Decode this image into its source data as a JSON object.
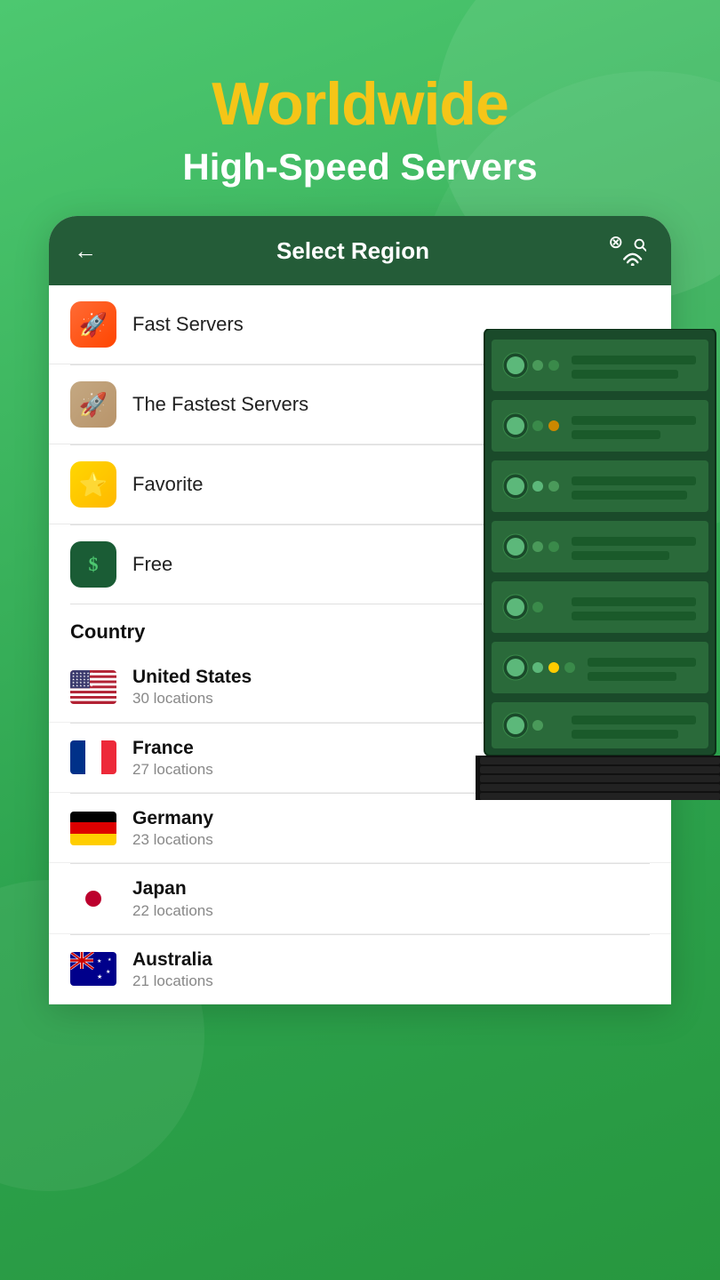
{
  "header": {
    "title_line1": "Worldwide",
    "title_line2": "High-Speed Servers"
  },
  "card": {
    "title": "Select Region",
    "back_label": "←"
  },
  "menu_items": [
    {
      "id": "fast-servers",
      "label": "Fast Servers",
      "icon": "🚀",
      "icon_style": "orange",
      "has_crown": false,
      "has_chevron": false
    },
    {
      "id": "fastest-servers",
      "label": "The Fastest Servers",
      "icon": "🚀",
      "icon_style": "tan",
      "has_crown": true,
      "has_chevron": false
    },
    {
      "id": "favorite",
      "label": "Favorite",
      "icon": "⭐",
      "icon_style": "yellow",
      "has_crown": false,
      "has_chevron": true
    },
    {
      "id": "free",
      "label": "Free",
      "icon": "$",
      "icon_style": "green",
      "has_crown": false,
      "has_chevron": true
    }
  ],
  "country_section": {
    "header": "Country",
    "countries": [
      {
        "id": "us",
        "name": "United States",
        "locations": "30 locations",
        "flag": "us"
      },
      {
        "id": "fr",
        "name": "France",
        "locations": "27 locations",
        "flag": "fr"
      },
      {
        "id": "de",
        "name": "Germany",
        "locations": "23 locations",
        "flag": "de"
      },
      {
        "id": "jp",
        "name": "Japan",
        "locations": "22 locations",
        "flag": "jp"
      },
      {
        "id": "au",
        "name": "Australia",
        "locations": "21 locations",
        "flag": "au"
      }
    ]
  },
  "colors": {
    "green_dark": "#245c38",
    "green_medium": "#3cb862",
    "yellow_accent": "#f5c518",
    "white": "#ffffff"
  }
}
